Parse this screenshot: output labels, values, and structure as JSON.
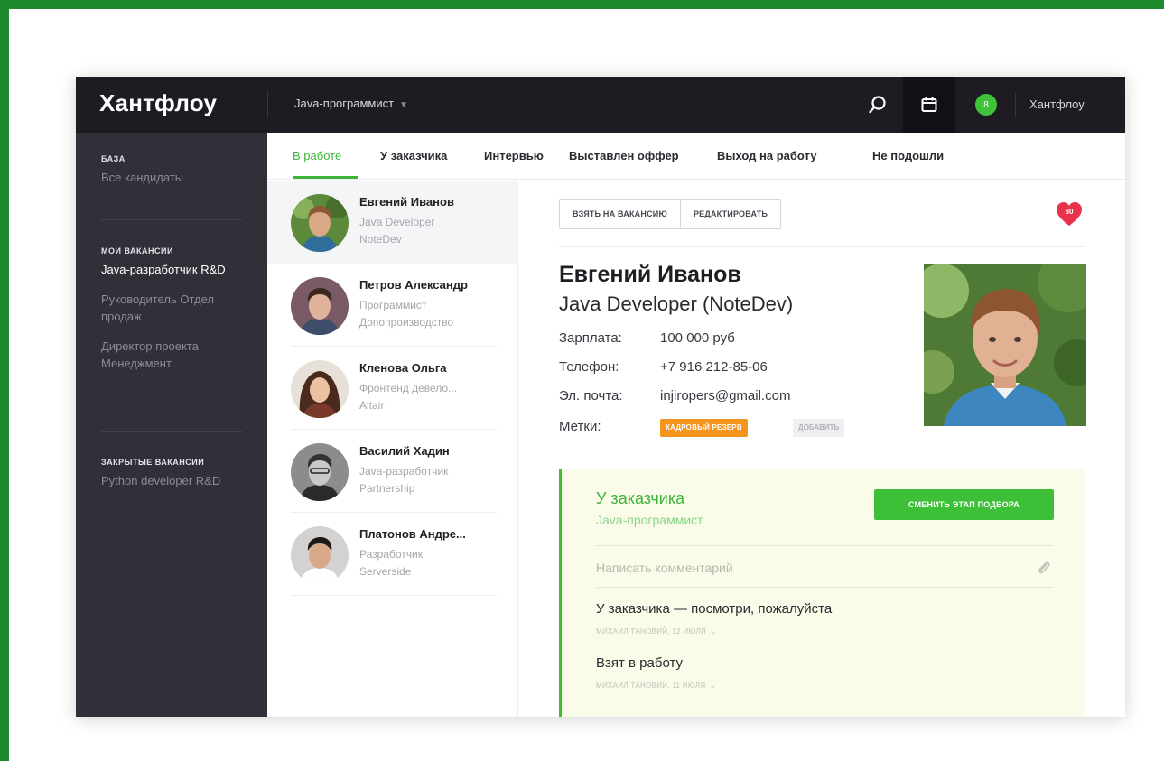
{
  "header": {
    "logo": "Хантфлоу",
    "vacancy_selector": "Java-программист",
    "notification_count": "8",
    "user_name": "Хантфлоу"
  },
  "sidebar": {
    "sections": [
      {
        "heading": "БАЗА",
        "items": [
          {
            "label": "Все кандидаты",
            "active": false
          }
        ]
      },
      {
        "heading": "МОИ ВАКАНСИИ",
        "items": [
          {
            "label": "Java-разработчик R&D",
            "active": true
          },
          {
            "label": "Руководитель Отдел продаж",
            "active": false
          },
          {
            "label": "Директор проекта Менеджмент",
            "active": false
          }
        ]
      },
      {
        "heading": "ЗАКРЫТЫЕ ВАКАНСИИ",
        "items": [
          {
            "label": "Python developer R&D",
            "active": false
          }
        ]
      }
    ]
  },
  "tabs": [
    {
      "label": "В работе",
      "active": true
    },
    {
      "label": "У заказчика",
      "active": false
    },
    {
      "label": "Интервью",
      "active": false
    },
    {
      "label": "Выставлен оффер",
      "active": false
    },
    {
      "label": "Выход на работу",
      "active": false
    },
    {
      "label": "Не подошли",
      "active": false
    }
  ],
  "candidates": [
    {
      "name": "Евгений Иванов",
      "role": "Java Developer",
      "company": "NoteDev",
      "active": true
    },
    {
      "name": "Петров Александр",
      "role": "Программист",
      "company": "Допопроизводство",
      "active": false
    },
    {
      "name": "Кленова Ольга",
      "role": "Фронтенд девело...",
      "company": "Altair",
      "active": false
    },
    {
      "name": "Василий Хадин",
      "role": "Java-разработчик",
      "company": "Partnership",
      "active": false
    },
    {
      "name": "Платонов Андре...",
      "role": "Разработчик",
      "company": "Serverside",
      "active": false
    }
  ],
  "detail": {
    "actions": {
      "take": "ВЗЯТЬ НА ВАКАНСИЮ",
      "edit": "РЕДАКТИРОВАТЬ"
    },
    "favorite_count": "80",
    "name": "Евгений Иванов",
    "title": "Java Developer (NoteDev)",
    "fields": {
      "salary_label": "Зарплата:",
      "salary_value": "100 000 руб",
      "phone_label": "Телефон:",
      "phone_value": "+7 916 212-85-06",
      "email_label": "Эл. почта:",
      "email_value": "injiropers@gmail.com",
      "tags_label": "Метки:"
    },
    "tags": {
      "reserve": "КАДРОВЫЙ РЕЗЕРВ",
      "add": "ДОБАВИТЬ"
    }
  },
  "stage": {
    "title": "У заказчика",
    "vacancy": "Java-программист",
    "change_button": "СМЕНИТЬ ЭТАП ПОДБОРА",
    "comment_placeholder": "Написать комментарий",
    "history": [
      {
        "text": "У заказчика — посмотри, пожалуйста",
        "meta": "МИХАИЛ ТАНОВИЙ, 12 ИЮЛЯ"
      },
      {
        "text": "Взят в работу",
        "meta": "МИХАИЛ ТАНОВИЙ, 11 ИЮЛЯ"
      }
    ]
  },
  "colors": {
    "frame_green": "#1e8a2e",
    "topbar": "#1e1b22",
    "sidebar": "#322f38",
    "accent_green": "#3dbf38",
    "tag_orange": "#f5951d",
    "heart_red": "#e8334a",
    "stage_bg": "#fafbe8"
  },
  "icons": [
    "search-icon",
    "calendar-icon",
    "heart-icon",
    "paperclip-icon",
    "chevron-down-icon"
  ]
}
